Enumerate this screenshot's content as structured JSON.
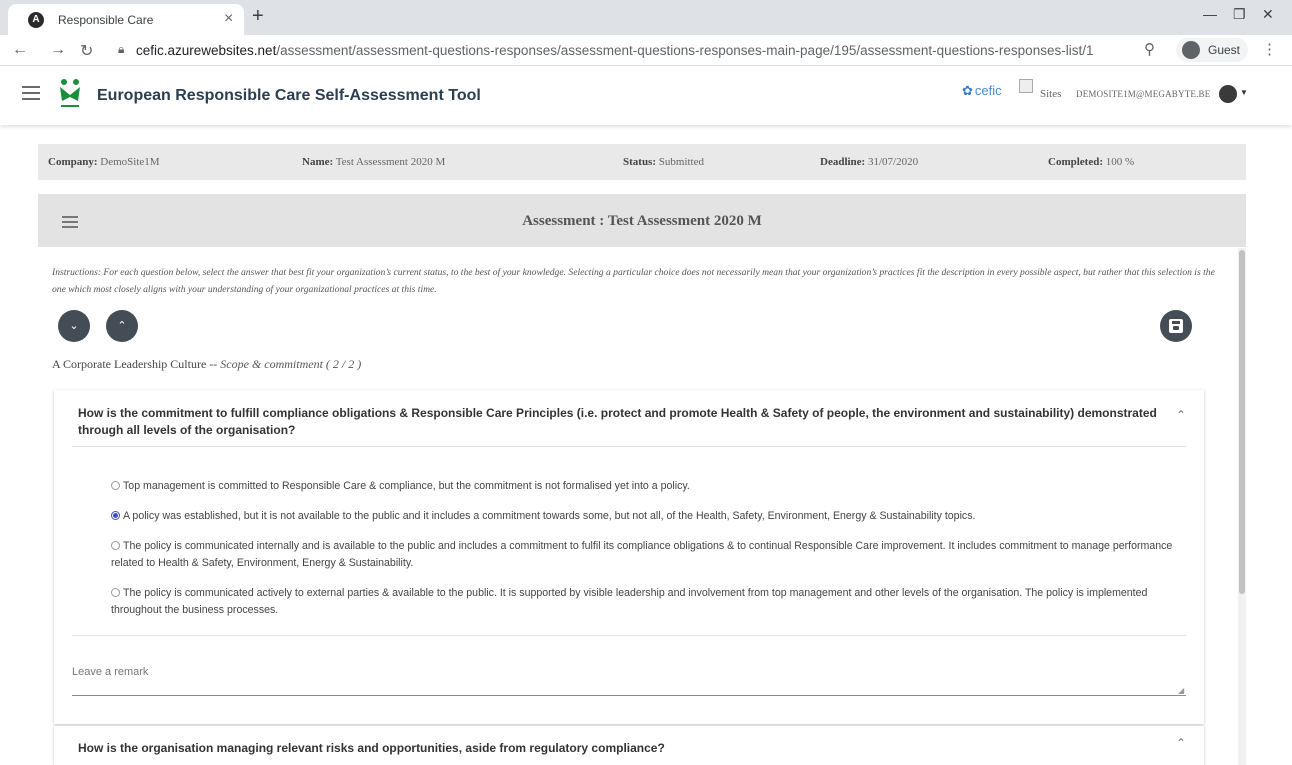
{
  "browser": {
    "tab_title": "Responsible Care",
    "tab_close": "×",
    "new_tab": "+",
    "url_domain": "cefic.azurewebsites.net",
    "url_path": "/assessment/assessment-questions-responses/assessment-questions-responses-main-page/195/assessment-questions-responses-list/1",
    "profile_label": "Guest"
  },
  "header": {
    "app_title": "European Responsible Care Self-Assessment Tool",
    "cefic_label": "cefic",
    "sites_label": "Sites",
    "user_email": "DEMOSITE1M@MEGABYTE.BE"
  },
  "info": {
    "company_label": "Company:",
    "company_value": "DemoSite1M",
    "name_label": "Name:",
    "name_value": "Test Assessment 2020 M",
    "status_label": "Status:",
    "status_value": "Submitted",
    "deadline_label": "Deadline:",
    "deadline_value": "31/07/2020",
    "completed_label": "Completed:",
    "completed_value": "100 %"
  },
  "assessment": {
    "title": "Assessment : Test Assessment 2020 M",
    "instructions": "Instructions: For each question below, select the answer that best fit your organization’s current status, to the best of your knowledge. Selecting a particular choice does not necessarily mean that your organization’s practices fit the description in every possible aspect, but rather that this selection is the one which most closely aligns with your understanding of your organizational practices at this time.",
    "section_name": "A Corporate Leadership Culture --",
    "section_sub": "Scope & commitment ( 2 / 2 )"
  },
  "question1": {
    "title": "How is the commitment to fulfill compliance obligations & Responsible Care Principles (i.e. protect and promote Health & Safety of people, the environment and sustainability) demonstrated through all levels of the organisation?",
    "options": [
      "Top management is committed to Responsible Care & compliance, but the commitment is not formalised yet into a policy.",
      "A policy was established, but it is not available to the public and it includes a commitment towards some, but not all, of the Health, Safety, Environment, Energy & Sustainability topics.",
      "The policy is communicated internally and is available to the public and includes a commitment to fulfil its compliance obligations & to continual Responsible Care improvement. It includes commitment to manage performance related to Health & Safety, Environment, Energy & Sustainability.",
      "The policy is communicated actively to external parties & available to the public. It is supported by visible leadership and involvement from top management and other levels of the organisation. The policy is implemented throughout the business processes."
    ],
    "selected_index": 1,
    "remark_placeholder": "Leave a remark"
  },
  "question2": {
    "title": "How is the organisation managing relevant risks and opportunities, aside from regulatory compliance?"
  },
  "colors": {
    "accent": "#3f51b5",
    "dark_button": "#444c55",
    "header_title": "#2c3e50"
  }
}
